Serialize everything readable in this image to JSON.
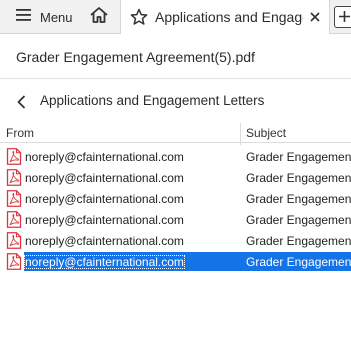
{
  "toolbar": {
    "menu_label": "Menu",
    "tab_title": "Applications and Engagement Letters"
  },
  "document": {
    "title": "Grader Engagement Agreement(5).pdf"
  },
  "folder": {
    "title": "Applications and Engagement Letters"
  },
  "list": {
    "columns": {
      "from": "From",
      "subject": "Subject"
    },
    "rows": [
      {
        "from": "noreply@cfainternational.com",
        "subject": "Grader Engagement Agreement",
        "selected": false
      },
      {
        "from": "noreply@cfainternational.com",
        "subject": "Grader Engagement Agreement",
        "selected": false
      },
      {
        "from": "noreply@cfainternational.com",
        "subject": "Grader Engagement Agreement",
        "selected": false
      },
      {
        "from": "noreply@cfainternational.com",
        "subject": "Grader Engagement Agreement",
        "selected": false
      },
      {
        "from": "noreply@cfainternational.com",
        "subject": "Grader Engagement Agreement",
        "selected": false
      },
      {
        "from": "noreply@cfainternational.com",
        "subject": "Grader Engagement Agreement",
        "selected": true
      }
    ]
  },
  "icons": {
    "menu": "hamburger-icon",
    "home": "home-icon",
    "bookmark": "star-icon",
    "close": "close-icon",
    "new_tab": "plus-icon",
    "back": "chevron-left-icon",
    "attachment": "pdf-file-icon"
  },
  "colors": {
    "selection": "#1473e6",
    "pdf_red": "#d7373f",
    "toolbar_bg": "#f1f1f1"
  }
}
